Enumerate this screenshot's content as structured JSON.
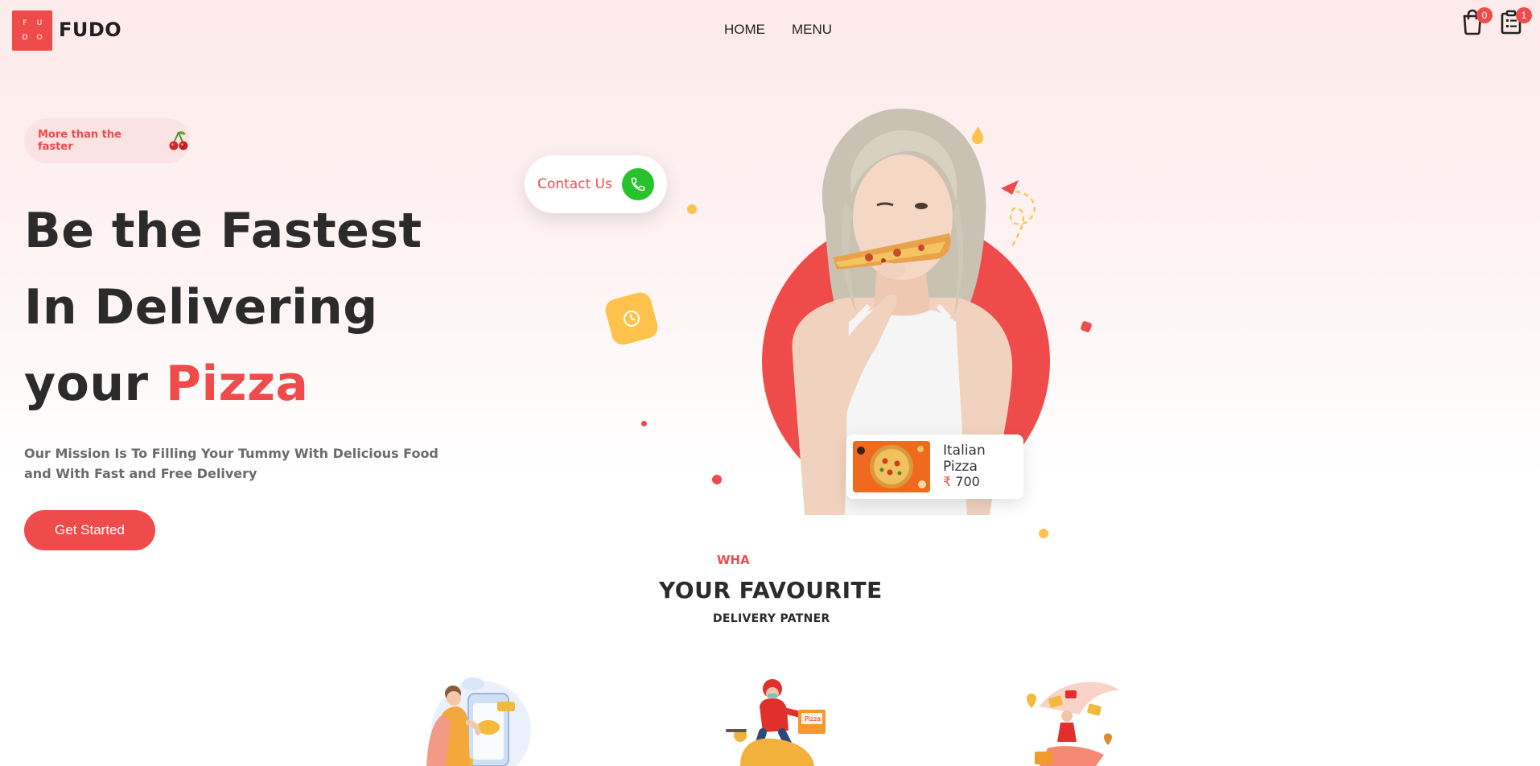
{
  "header": {
    "logo_letters": [
      "F",
      "U",
      "D",
      "O"
    ],
    "brand": "FUDO",
    "nav": [
      {
        "label": "HOME",
        "icon": null
      },
      {
        "label": "MENU",
        "icon": null
      }
    ],
    "cart": {
      "icon": "shopping-bag-icon",
      "count": "0"
    },
    "orders": {
      "icon": "order-list-icon",
      "count": "1"
    }
  },
  "hero": {
    "tag": "More than the faster",
    "tag_icon": "cherry-icon",
    "headline_line1": "Be the Fastest",
    "headline_line2": "In Delivering",
    "headline_line3_plain": "your",
    "headline_line3_accent": "Pizza",
    "mission": "Our Mission Is To Filling Your Tummy With Delicious Food and With Fast and Free Delivery",
    "cta": "Get Started"
  },
  "contact": {
    "label": "Contact Us",
    "icon": "phone-icon"
  },
  "product_card": {
    "name": "Italian Pizza",
    "currency": "₹",
    "price": "700"
  },
  "section": {
    "kicker": "WHA",
    "title": "YOUR FAVOURITE",
    "subtitle": "DELIVERY PATNER"
  },
  "colors": {
    "accent": "#f04b4b",
    "green": "#27c22c",
    "yellow": "#fcc24b",
    "text": "#2b2b2b"
  }
}
